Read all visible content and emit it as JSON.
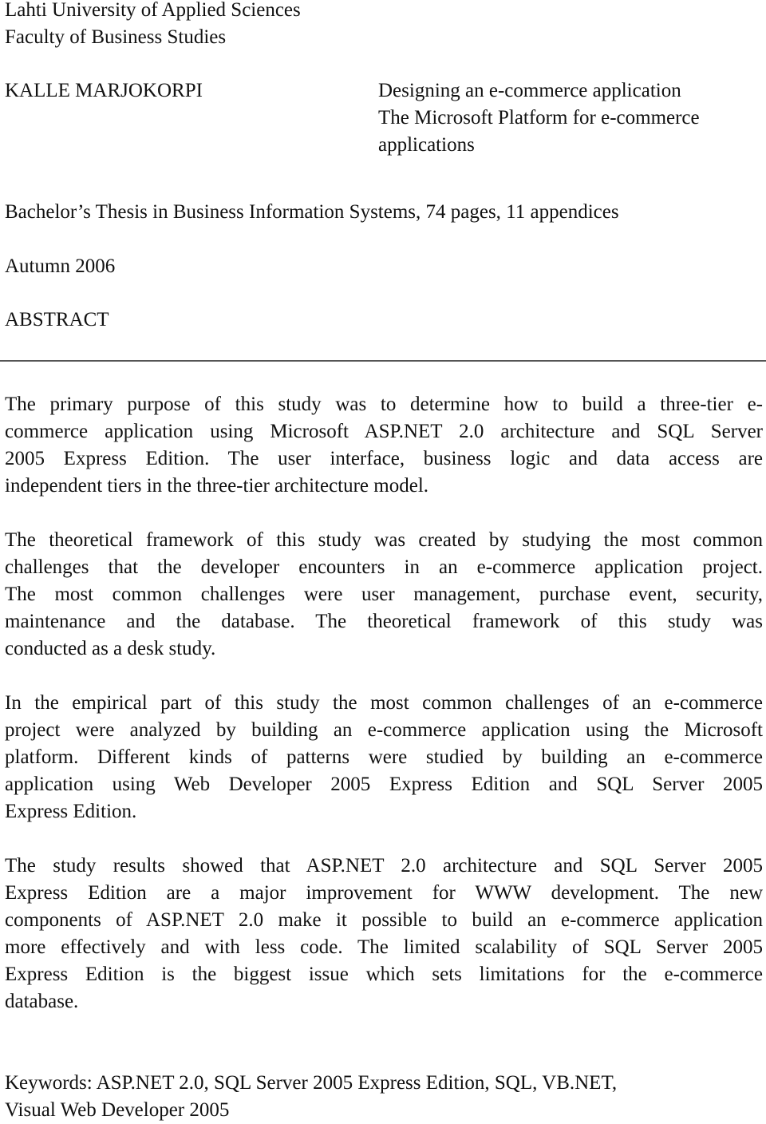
{
  "header": {
    "institution": "Lahti University of Applied Sciences",
    "faculty": "Faculty of Business Studies",
    "author": "KALLE MARJOKORPI",
    "title_lines": [
      "Designing an e-commerce application",
      "The Microsoft Platform for e-commerce",
      "applications"
    ],
    "thesis_info": "Bachelor’s Thesis in Business Information Systems, 74 pages, 11 appendices",
    "term": "Autumn 2006",
    "section_heading": "ABSTRACT"
  },
  "abstract": {
    "paragraphs": [
      {
        "lines": [
          "The primary purpose of this study was to determine how to build a three-tier e-",
          "commerce application using Microsoft ASP.NET 2.0 architecture and SQL Server",
          "2005 Express Edition. The user interface, business logic and data access are",
          "independent tiers in the three-tier architecture model."
        ]
      },
      {
        "lines": [
          "The theoretical framework of this study was created by studying the most common",
          "challenges that the developer encounters in an e-commerce application project.",
          "The most common challenges were user management, purchase event, security,",
          "maintenance and the database. The theoretical framework of this study was",
          "conducted as a desk study."
        ]
      },
      {
        "lines": [
          "In the empirical part of this study the most common challenges of an e-commerce",
          "project were analyzed by building an e-commerce application using the Microsoft",
          "platform. Different kinds of patterns were studied by building an e-commerce",
          "application using Web Developer 2005 Express Edition and SQL Server 2005",
          "Express Edition."
        ]
      },
      {
        "lines": [
          "The study results showed that ASP.NET 2.0 architecture and SQL Server 2005",
          "Express Edition are a major improvement for WWW development. The new",
          "components of ASP.NET 2.0 make it possible to build an e-commerce application",
          "more effectively and with less code. The limited scalability of SQL Server 2005",
          "Express Edition is the biggest issue which sets limitations for the e-commerce",
          "database."
        ]
      }
    ]
  },
  "keywords": {
    "lines": [
      "Keywords: ASP.NET 2.0, SQL Server 2005 Express Edition, SQL, VB.NET,",
      "Visual Web Developer 2005"
    ]
  }
}
